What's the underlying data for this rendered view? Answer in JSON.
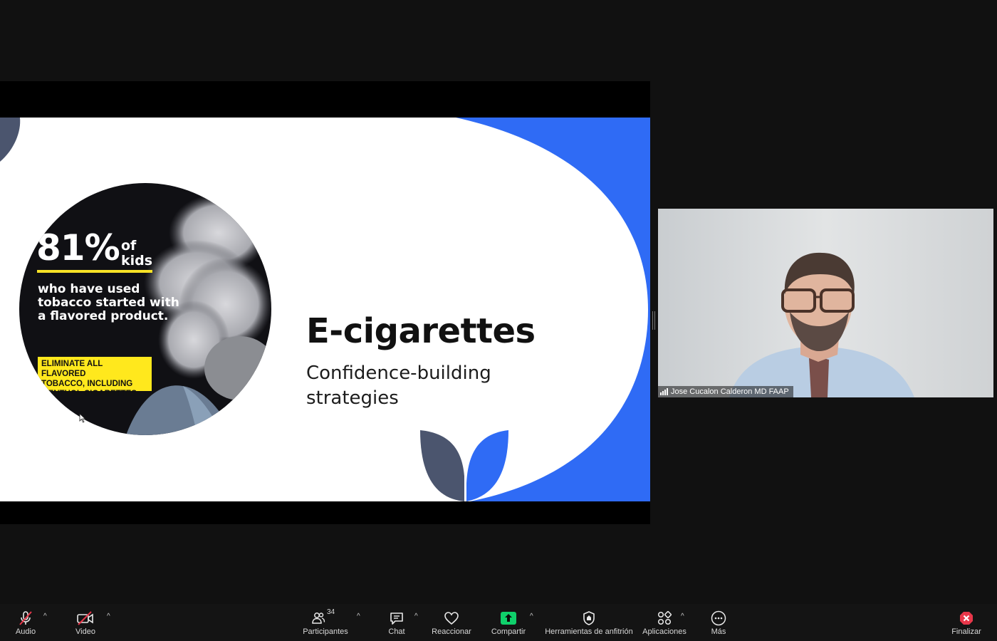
{
  "slide": {
    "stat_number": "81%",
    "stat_suffix": "of\nkids",
    "stat_description": "who have used\ntobacco started with\na flavored product.",
    "banner_text": "ELIMINATE ALL FLAVORED\nTOBACCO, INCLUDING\nMENTHOL CIGARETTES",
    "title": "E-cigarettes",
    "subtitle": "Confidence-building\nstrategies",
    "colors": {
      "accent_blue": "#2f6bf5",
      "leaf_gray": "#4b556e",
      "banner_yellow": "#ffe81d",
      "stat_underline": "#f7e226"
    }
  },
  "participant": {
    "name": "Jose Cucalon Calderon MD FAAP",
    "icon": "signal-strength-icon"
  },
  "toolbar": {
    "audio": {
      "label": "Audio",
      "icon": "microphone-muted-icon"
    },
    "video": {
      "label": "Video",
      "icon": "video-camera-off-icon"
    },
    "participants": {
      "label": "Participantes",
      "count": "34",
      "icon": "participants-icon"
    },
    "chat": {
      "label": "Chat",
      "icon": "chat-icon"
    },
    "react": {
      "label": "Reaccionar",
      "icon": "heart-icon"
    },
    "share": {
      "label": "Compartir",
      "icon": "share-screen-icon",
      "color": "#0fd06b"
    },
    "host_tools": {
      "label": "Herramientas de anfitrión",
      "icon": "shield-icon"
    },
    "apps": {
      "label": "Aplicaciones",
      "icon": "apps-icon"
    },
    "more": {
      "label": "Más",
      "icon": "more-dots-icon"
    },
    "end": {
      "label": "Finalizar",
      "icon": "end-meeting-icon",
      "color": "#e8374a"
    },
    "caret_glyph": "^"
  }
}
